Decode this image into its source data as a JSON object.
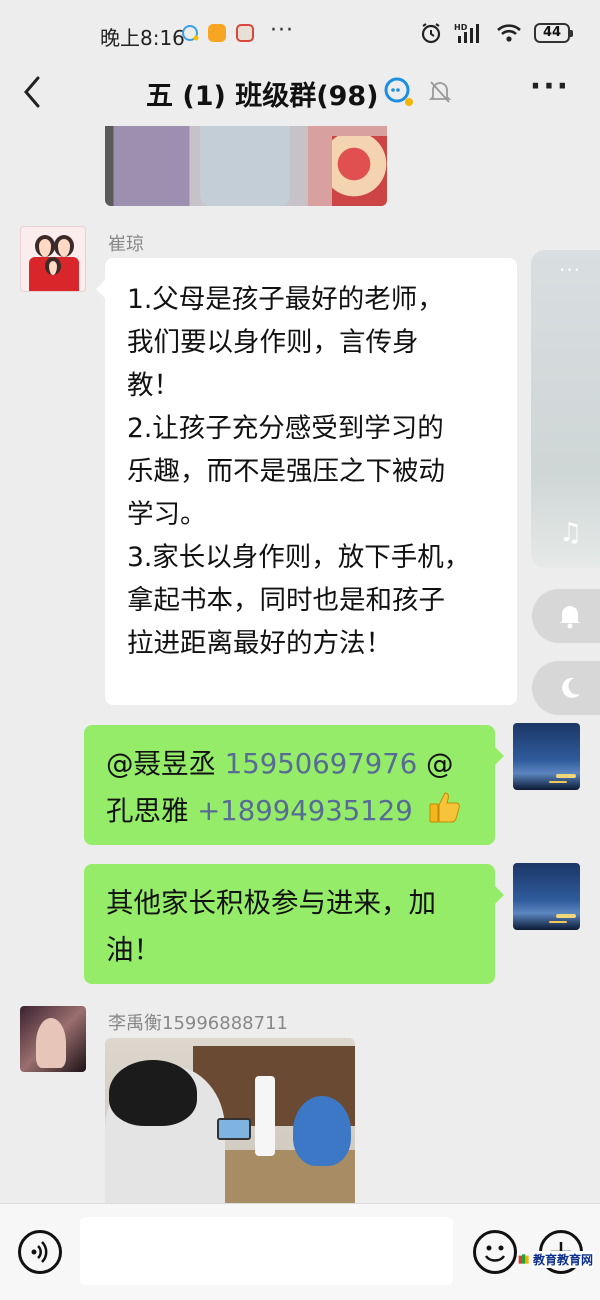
{
  "status_bar": {
    "time": "晚上8:16",
    "signal_label": "HD",
    "battery": "44"
  },
  "header": {
    "title": "五 (1) 班级群(98)",
    "back_icon": "chevron-left-icon",
    "more_icon": "more-dots-icon"
  },
  "messages": [
    {
      "type": "image",
      "side": "left",
      "description_icon": "photo-thumbnail"
    },
    {
      "type": "text",
      "side": "left",
      "sender": "崔琼",
      "lines": [
        "1.父母是孩子最好的老师，",
        "我们要以身作则，言传身",
        "教！",
        "2.让孩子充分感受到学习的",
        "乐趣，而不是强压之下被动",
        "学习。",
        "3.家长以身作则，放下手机，",
        "拿起书本，同时也是和孩子",
        "拉进距离最好的方法！"
      ]
    },
    {
      "type": "text",
      "side": "right",
      "mention1": "@聂昱丞",
      "phone1": "15950697976",
      "mention2_prefix": "@",
      "mention2": "孔思雅",
      "phone2": "+18994935129"
    },
    {
      "type": "text",
      "side": "right",
      "line1": "其他家长积极参与进来，加",
      "line2": "油！"
    },
    {
      "type": "image",
      "side": "left",
      "sender": "李禹衡15996888711"
    }
  ],
  "input": {
    "placeholder": "",
    "value": ""
  },
  "watermark": {
    "text": "教育教育网"
  },
  "colors": {
    "background": "#ededed",
    "green_bubble": "#95ec69",
    "white_bubble": "#ffffff",
    "link": "#576b95"
  }
}
